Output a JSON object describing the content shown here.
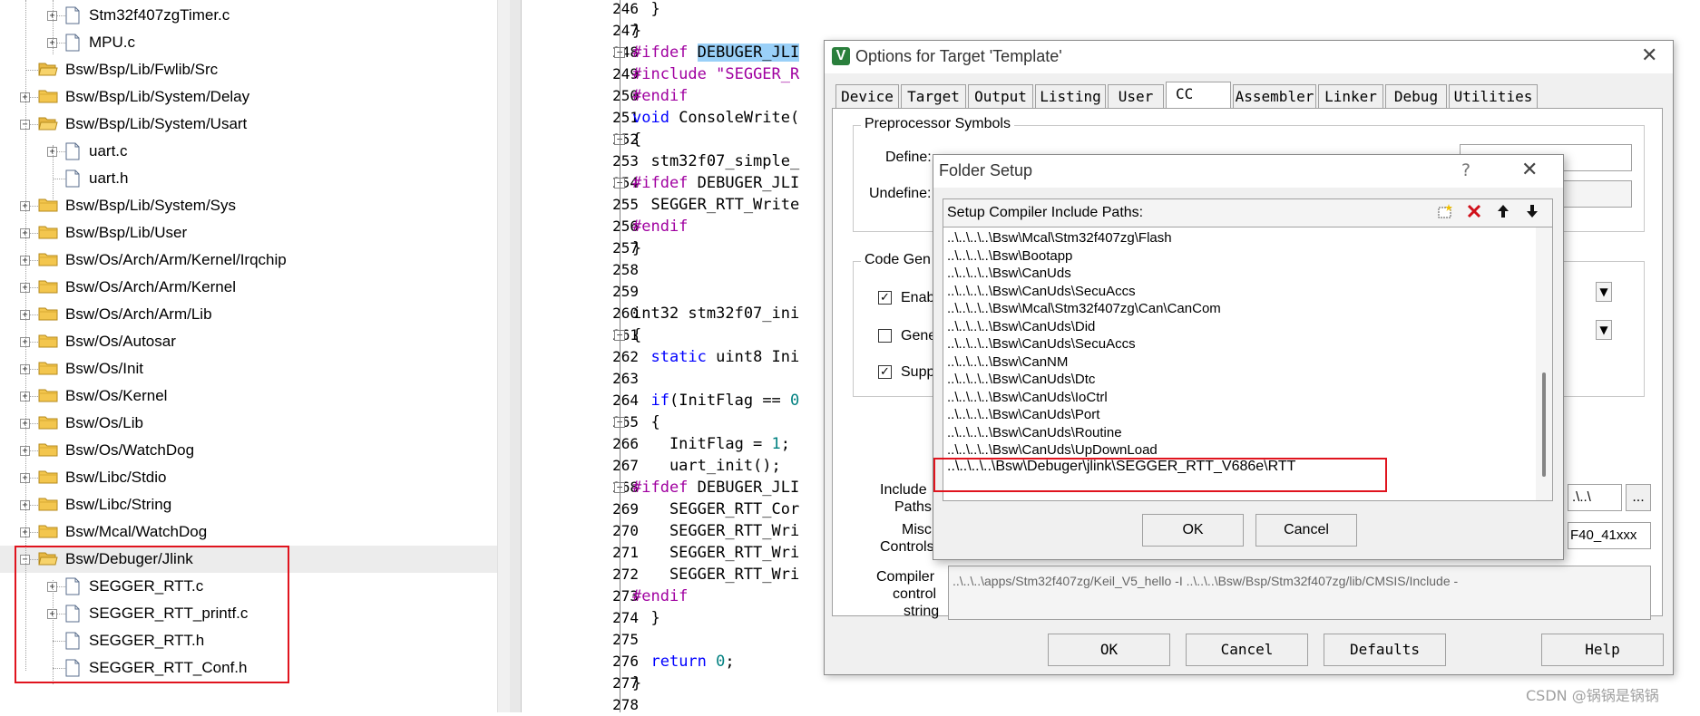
{
  "tree": {
    "items": [
      {
        "label": "Stm32f407zgTimer.c",
        "type": "file",
        "level": 2,
        "expand": "+"
      },
      {
        "label": "MPU.c",
        "type": "file",
        "level": 2,
        "expand": "+"
      },
      {
        "label": "Bsw/Bsp/Lib/Fwlib/Src",
        "type": "folder-open",
        "level": 1,
        "expand": ""
      },
      {
        "label": "Bsw/Bsp/Lib/System/Delay",
        "type": "folder",
        "level": 1,
        "expand": "+"
      },
      {
        "label": "Bsw/Bsp/Lib/System/Usart",
        "type": "folder-open",
        "level": 1,
        "expand": "-"
      },
      {
        "label": "uart.c",
        "type": "file",
        "level": 2,
        "expand": "+"
      },
      {
        "label": "uart.h",
        "type": "file",
        "level": 2,
        "expand": ""
      },
      {
        "label": "Bsw/Bsp/Lib/System/Sys",
        "type": "folder",
        "level": 1,
        "expand": "+"
      },
      {
        "label": "Bsw/Bsp/Lib/User",
        "type": "folder",
        "level": 1,
        "expand": "+"
      },
      {
        "label": "Bsw/Os/Arch/Arm/Kernel/Irqchip",
        "type": "folder",
        "level": 1,
        "expand": "+"
      },
      {
        "label": "Bsw/Os/Arch/Arm/Kernel",
        "type": "folder",
        "level": 1,
        "expand": "+"
      },
      {
        "label": "Bsw/Os/Arch/Arm/Lib",
        "type": "folder",
        "level": 1,
        "expand": "+"
      },
      {
        "label": "Bsw/Os/Autosar",
        "type": "folder",
        "level": 1,
        "expand": "+"
      },
      {
        "label": "Bsw/Os/Init",
        "type": "folder",
        "level": 1,
        "expand": "+"
      },
      {
        "label": "Bsw/Os/Kernel",
        "type": "folder",
        "level": 1,
        "expand": "+"
      },
      {
        "label": "Bsw/Os/Lib",
        "type": "folder",
        "level": 1,
        "expand": "+"
      },
      {
        "label": "Bsw/Os/WatchDog",
        "type": "folder",
        "level": 1,
        "expand": "+"
      },
      {
        "label": "Bsw/Libc/Stdio",
        "type": "folder",
        "level": 1,
        "expand": "+"
      },
      {
        "label": "Bsw/Libc/String",
        "type": "folder",
        "level": 1,
        "expand": "+"
      },
      {
        "label": "Bsw/Mcal/WatchDog",
        "type": "folder",
        "level": 1,
        "expand": "+"
      },
      {
        "label": "Bsw/Debuger/Jlink",
        "type": "folder-open",
        "level": 1,
        "expand": "-",
        "selected": true
      },
      {
        "label": "SEGGER_RTT.c",
        "type": "file",
        "level": 2,
        "expand": "+"
      },
      {
        "label": "SEGGER_RTT_printf.c",
        "type": "file",
        "level": 2,
        "expand": "+"
      },
      {
        "label": "SEGGER_RTT.h",
        "type": "file",
        "level": 2,
        "expand": ""
      },
      {
        "label": "SEGGER_RTT_Conf.h",
        "type": "file",
        "level": 2,
        "expand": ""
      }
    ]
  },
  "editor": {
    "lines": [
      {
        "n": "246",
        "fold": "",
        "segs": [
          {
            "t": "  }"
          }
        ]
      },
      {
        "n": "247",
        "fold": "",
        "segs": [
          {
            "t": "}"
          }
        ]
      },
      {
        "n": "248",
        "fold": "-",
        "segs": [
          {
            "t": "#ifdef ",
            "c": "pp"
          },
          {
            "t": "DEBUGER_JLI",
            "c": "hl"
          }
        ]
      },
      {
        "n": "249",
        "fold": "",
        "segs": [
          {
            "t": "#include ",
            "c": "pp"
          },
          {
            "t": "\"SEGGER_R",
            "c": "str"
          }
        ]
      },
      {
        "n": "250",
        "fold": "",
        "segs": [
          {
            "t": "#endif",
            "c": "pp"
          }
        ]
      },
      {
        "n": "251",
        "fold": "",
        "segs": [
          {
            "t": "void ",
            "c": "kw"
          },
          {
            "t": "ConsoleWrite("
          }
        ]
      },
      {
        "n": "252",
        "fold": "-",
        "segs": [
          {
            "t": "{"
          }
        ]
      },
      {
        "n": "253",
        "fold": "",
        "segs": [
          {
            "t": "  stm32f07_simple_"
          }
        ]
      },
      {
        "n": "254",
        "fold": "-",
        "segs": [
          {
            "t": "#ifdef ",
            "c": "pp"
          },
          {
            "t": "DEBUGER_JLI"
          }
        ]
      },
      {
        "n": "255",
        "fold": "",
        "segs": [
          {
            "t": "  SEGGER_RTT_Write"
          }
        ]
      },
      {
        "n": "256",
        "fold": "",
        "segs": [
          {
            "t": "#endif",
            "c": "pp"
          }
        ]
      },
      {
        "n": "257",
        "fold": "",
        "segs": [
          {
            "t": "}"
          }
        ]
      },
      {
        "n": "258",
        "fold": "",
        "segs": [
          {
            "t": ""
          }
        ]
      },
      {
        "n": "259",
        "fold": "",
        "segs": [
          {
            "t": ""
          }
        ]
      },
      {
        "n": "260",
        "fold": "",
        "segs": [
          {
            "t": "int32 stm32f07_ini"
          }
        ]
      },
      {
        "n": "261",
        "fold": "-",
        "segs": [
          {
            "t": "{"
          }
        ]
      },
      {
        "n": "262",
        "fold": "",
        "segs": [
          {
            "t": "  "
          },
          {
            "t": "static ",
            "c": "kw"
          },
          {
            "t": "uint8 Ini"
          }
        ]
      },
      {
        "n": "263",
        "fold": "",
        "segs": [
          {
            "t": ""
          }
        ]
      },
      {
        "n": "264",
        "fold": "",
        "segs": [
          {
            "t": "  "
          },
          {
            "t": "if",
            "c": "kw"
          },
          {
            "t": "(InitFlag == "
          },
          {
            "t": "0",
            "c": "num"
          }
        ]
      },
      {
        "n": "265",
        "fold": "-",
        "segs": [
          {
            "t": "  {"
          }
        ]
      },
      {
        "n": "266",
        "fold": "",
        "segs": [
          {
            "t": "    InitFlag = "
          },
          {
            "t": "1",
            "c": "num"
          },
          {
            "t": ";"
          }
        ]
      },
      {
        "n": "267",
        "fold": "",
        "segs": [
          {
            "t": "    uart_init();"
          }
        ]
      },
      {
        "n": "268",
        "fold": "-",
        "segs": [
          {
            "t": "#ifdef ",
            "c": "pp"
          },
          {
            "t": "DEBUGER_JLI"
          }
        ]
      },
      {
        "n": "269",
        "fold": "",
        "segs": [
          {
            "t": "    SEGGER_RTT_Cor"
          }
        ]
      },
      {
        "n": "270",
        "fold": "",
        "segs": [
          {
            "t": "    SEGGER_RTT_Wri"
          }
        ]
      },
      {
        "n": "271",
        "fold": "",
        "segs": [
          {
            "t": "    SEGGER_RTT_Wri"
          }
        ]
      },
      {
        "n": "272",
        "fold": "",
        "segs": [
          {
            "t": "    SEGGER_RTT_Wri"
          }
        ]
      },
      {
        "n": "273",
        "fold": "",
        "segs": [
          {
            "t": "#endif",
            "c": "pp"
          }
        ]
      },
      {
        "n": "274",
        "fold": "",
        "segs": [
          {
            "t": "  }"
          }
        ]
      },
      {
        "n": "275",
        "fold": "",
        "segs": [
          {
            "t": ""
          }
        ]
      },
      {
        "n": "276",
        "fold": "",
        "segs": [
          {
            "t": "  "
          },
          {
            "t": "return ",
            "c": "kw"
          },
          {
            "t": "0",
            "c": "num"
          },
          {
            "t": ";"
          }
        ]
      },
      {
        "n": "277",
        "fold": "",
        "segs": [
          {
            "t": "}"
          }
        ]
      },
      {
        "n": "278",
        "fold": "",
        "segs": [
          {
            "t": ""
          }
        ]
      }
    ]
  },
  "options": {
    "title": "Options for Target 'Template'",
    "tabs": [
      "Device",
      "Target",
      "Output",
      "Listing",
      "User",
      "CC",
      "Assembler",
      "Linker",
      "Debug",
      "Utilities"
    ],
    "active_tab": "CC",
    "preprocessor_title": "Preprocessor Symbols",
    "define_label": "Define:",
    "undefine_label": "Undefine:",
    "codegen_title": "Code Gen",
    "chk1_label": "Enab",
    "chk2_label": "Gene",
    "chk3_label": "Supp",
    "include_label_1": "Include",
    "include_label_2": "Paths",
    "include_value": ".\\..\\",
    "browse_label": "...",
    "misc_label_1": "Misc",
    "misc_label_2": "Controls",
    "misc_value": "F40_41xxx",
    "compiler_label_1": "Compiler",
    "compiler_label_2": "control",
    "compiler_label_3": "string",
    "compiler_value": "..\\..\\..\\apps/Stm32f407zg/Keil_V5_hello -I ..\\..\\..\\Bsw/Bsp/Stm32f407zg/lib/CMSIS/Include -",
    "ok": "OK",
    "cancel": "Cancel",
    "defaults": "Defaults",
    "help": "Help"
  },
  "folder_setup": {
    "title": "Folder Setup",
    "help_glyph": "?",
    "header": "Setup Compiler Include Paths:",
    "paths": [
      "..\\..\\..\\..\\Bsw\\Mcal\\Stm32f407zg\\Flash",
      "..\\..\\..\\..\\Bsw\\Bootapp",
      "..\\..\\..\\..\\Bsw\\CanUds",
      "..\\..\\..\\..\\Bsw\\CanUds\\SecuAccs",
      "..\\..\\..\\..\\Bsw\\Mcal\\Stm32f407zg\\Can\\CanCom",
      "..\\..\\..\\..\\Bsw\\CanUds\\Did",
      "..\\..\\..\\..\\Bsw\\CanUds\\SecuAccs",
      "..\\..\\..\\..\\Bsw\\CanNM",
      "..\\..\\..\\..\\Bsw\\CanUds\\Dtc",
      "..\\..\\..\\..\\Bsw\\CanUds\\IoCtrl",
      "..\\..\\..\\..\\Bsw\\CanUds\\Port",
      "..\\..\\..\\..\\Bsw\\CanUds\\Routine",
      "..\\..\\..\\..\\Bsw\\CanUds\\UpDownLoad",
      "..\\..\\..\\..\\Bsw\\Debuger\\jlink\\SEGGER_RTT_V686e\\RTT"
    ],
    "ok": "OK",
    "cancel": "Cancel"
  },
  "watermark": "CSDN @锅锅是锅锅",
  "colors": {
    "highlight_box": "#e0141e",
    "selection": "#9ad0f8"
  }
}
